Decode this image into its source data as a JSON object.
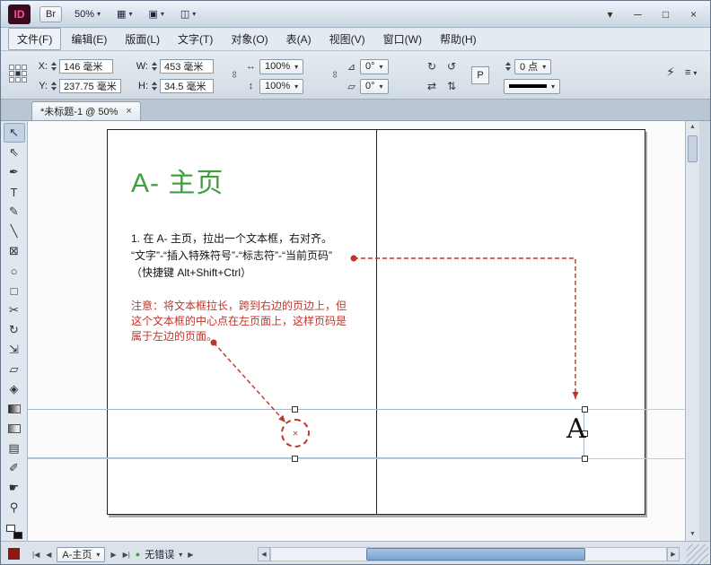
{
  "colors": {
    "accent-green": "#3fa03f",
    "annotation-red": "#c0362c",
    "scroll-thumb": "#7aa3d4",
    "status-green": "#2fae2f",
    "logo-pink": "#ff4fa0",
    "logo-bg": "#3a0a1e"
  },
  "title_bar": {
    "app_logo": "ID",
    "bridge_label": "Br",
    "zoom_value": "50%"
  },
  "menu_bar": {
    "items": [
      {
        "label": "文件(F)"
      },
      {
        "label": "编辑(E)"
      },
      {
        "label": "版面(L)"
      },
      {
        "label": "文字(T)"
      },
      {
        "label": "对象(O)"
      },
      {
        "label": "表(A)"
      },
      {
        "label": "视图(V)"
      },
      {
        "label": "窗口(W)"
      },
      {
        "label": "帮助(H)"
      }
    ]
  },
  "control_bar": {
    "x_label": "X:",
    "x_value": "146 毫米",
    "y_label": "Y:",
    "y_value": "237.75 毫米",
    "w_label": "W:",
    "w_value": "453 毫米",
    "h_label": "H:",
    "h_value": "34.5 毫米",
    "scale_x": "100%",
    "scale_y": "100%",
    "rotation": "0°",
    "shear": "0°",
    "stroke_weight": "0 点"
  },
  "icons": {
    "view_grid": "▦",
    "screen_mode": "▣",
    "arrange_docs": "◫",
    "caret": "▾",
    "minimize": "─",
    "maximize": "□",
    "close": "×",
    "scale_x": "↔",
    "scale_y": "↕",
    "chain": "∞",
    "rotation": "⊿",
    "shear": "▱",
    "rotate_cw": "↻",
    "rotate_ccw": "↺",
    "flip_h": "⇄",
    "flip_v": "⇅",
    "p_badge": "P",
    "lightning": "⚡",
    "panel_menu": "≡",
    "tab_close": "×",
    "nav_first": "|◀",
    "nav_prev": "◀",
    "nav_next": "▶",
    "nav_last": "▶|",
    "preflight_dot": "●",
    "status_expand": "▶",
    "scroll_up": "▲",
    "scroll_down": "▼",
    "scroll_left": "◀",
    "scroll_right": "▶",
    "center_mark": "✕"
  },
  "document_tab": {
    "label": "*未标题-1 @ 50%"
  },
  "tools": [
    {
      "name": "selection-tool",
      "glyph": "↖"
    },
    {
      "name": "direct-selection-tool",
      "glyph": "⇖"
    },
    {
      "name": "pen-tool",
      "glyph": "✒"
    },
    {
      "name": "type-tool",
      "glyph": "T"
    },
    {
      "name": "pencil-tool",
      "glyph": "✎"
    },
    {
      "name": "line-tool",
      "glyph": "╲"
    },
    {
      "name": "rectangle-frame-tool",
      "glyph": "⊠"
    },
    {
      "name": "ellipse-tool",
      "glyph": "○"
    },
    {
      "name": "rectangle-tool",
      "glyph": "□"
    },
    {
      "name": "scissors-tool",
      "glyph": "✂"
    },
    {
      "name": "rotate-tool",
      "glyph": "↻"
    },
    {
      "name": "scale-tool",
      "glyph": "⇲"
    },
    {
      "name": "shear-tool",
      "glyph": "▱"
    },
    {
      "name": "free-transform-tool",
      "glyph": "◈"
    },
    {
      "name": "gradient-swatch-tool",
      "glyph": ""
    },
    {
      "name": "gradient-feather-tool",
      "glyph": ""
    },
    {
      "name": "note-tool",
      "glyph": "▤"
    },
    {
      "name": "eyedropper-tool",
      "glyph": "✐"
    },
    {
      "name": "hand-tool",
      "glyph": "☛"
    },
    {
      "name": "zoom-tool",
      "glyph": "⚲"
    }
  ],
  "page_content": {
    "heading": "A- 主页",
    "body_lines": [
      "1. 在 A- 主页，拉出一个文本框，右对齐。",
      "“文字”-“插入特殊符号”-“标志符”-“当前页码”",
      "（快捷键 Alt+Shift+Ctrl）"
    ],
    "note_lines": [
      "注意：将文本框拉长，跨到右边的页边上，但",
      "这个文本框的中心点在左页面上，这样页码是",
      "属于左边的页面。"
    ],
    "page_number_char": "A"
  },
  "status_bar": {
    "page_name": "A-主页",
    "preflight_text": "无错误"
  }
}
